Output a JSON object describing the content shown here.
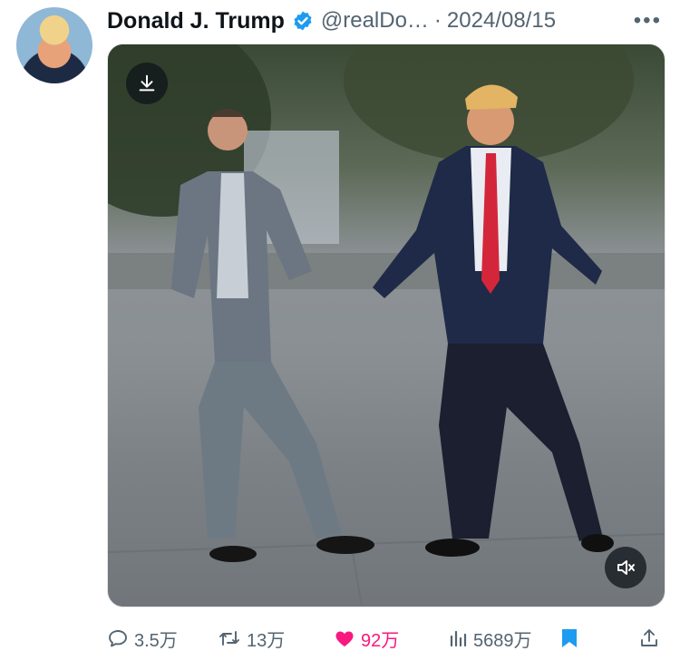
{
  "tweet": {
    "author_name": "Donald J. Trump",
    "handle": "@realDo…",
    "separator": "·",
    "date": "2024/08/15",
    "more_icon": "more-horizontal-icon"
  },
  "media": {
    "download_icon": "download-icon",
    "mute_icon": "volume-muted-icon"
  },
  "actions": {
    "replies": "3.5万",
    "retweets": "13万",
    "likes": "92万",
    "views": "5689万"
  },
  "colors": {
    "like_active": "#f91880",
    "bookmark_active": "#1d9bf0",
    "verified": "#1d9bf0",
    "secondary_text": "#536471"
  }
}
